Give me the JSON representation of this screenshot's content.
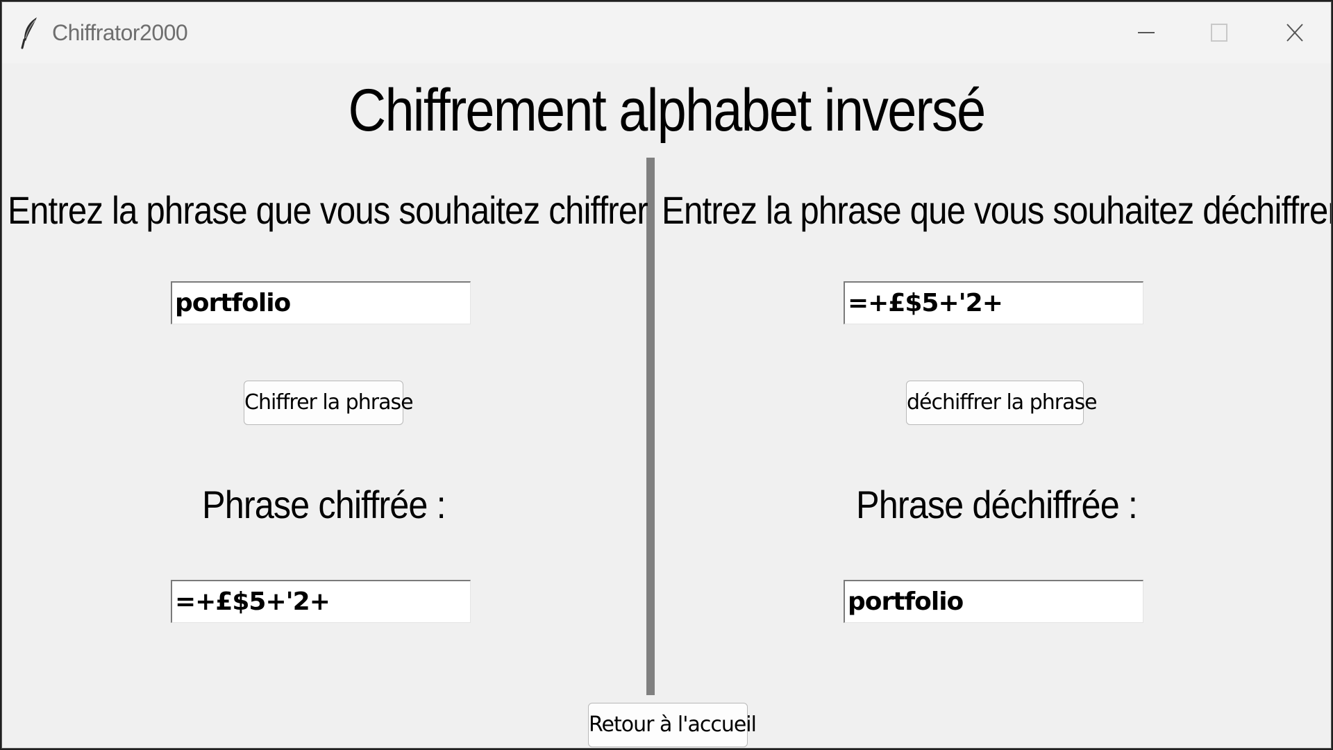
{
  "window": {
    "title": "Chiffrator2000",
    "icon": "feather-icon",
    "controls": [
      "minimize-icon",
      "maximize-icon",
      "close-icon"
    ]
  },
  "main_title": "Chiffrement alphabet inversé",
  "encrypt_panel": {
    "heading": "Entrez la phrase que vous souhaitez chiffrer",
    "input_value": "portfolio",
    "button_label": "Chiffrer la phrase",
    "result_label": "Phrase chiffrée :",
    "result_value": "=+£$5+'2+"
  },
  "decrypt_panel": {
    "heading": "Entrez la phrase que vous souhaitez déchiffrer",
    "input_value": "=+£$5+'2+",
    "button_label": "déchiffrer la phrase",
    "result_label": "Phrase déchiffrée :",
    "result_value": "portfolio"
  },
  "footer": {
    "home_button_label": "Retour à l'accueil"
  },
  "colors": {
    "window_bg": "#f0f0f0",
    "divider": "#808080",
    "title_text": "#6e6e6e"
  }
}
